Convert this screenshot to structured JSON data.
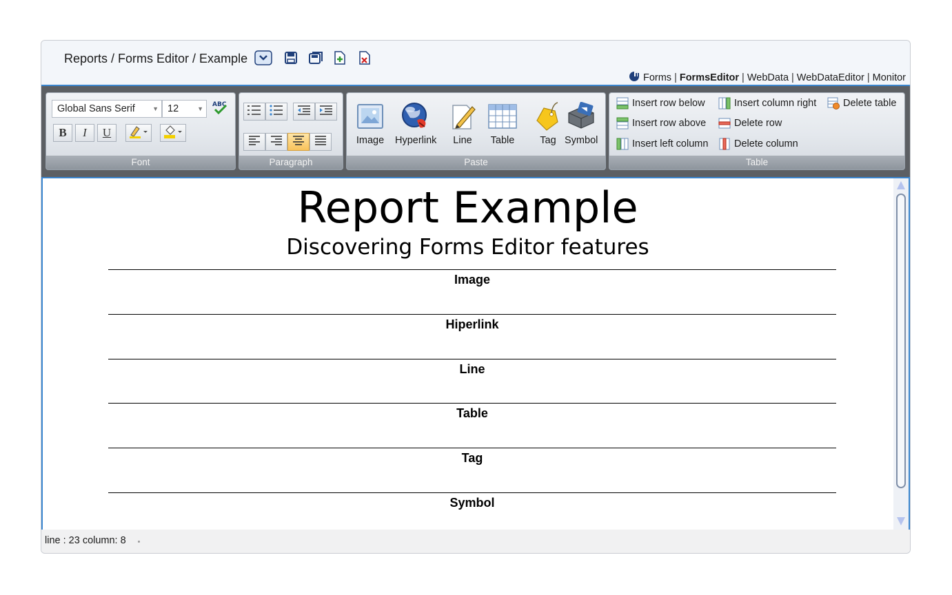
{
  "window": {
    "breadcrumb": "Reports / Forms Editor / Example",
    "toolbar_icons": [
      "chevron-down-icon",
      "save-icon",
      "save-as-icon",
      "new-document-icon",
      "close-document-icon"
    ]
  },
  "nav": {
    "links": [
      "Forms",
      "FormsEditor",
      "WebData",
      "WebDataEditor",
      "Monitor"
    ],
    "active": "FormsEditor",
    "separator": "|"
  },
  "ribbon": {
    "font": {
      "label": "Font",
      "family": "Global Sans Serif",
      "size": "12",
      "bold": "B",
      "italic": "I",
      "underline": "U"
    },
    "paragraph": {
      "label": "Paragraph",
      "selected_alignment": "center"
    },
    "paste": {
      "label": "Paste",
      "items": [
        "Image",
        "Hyperlink",
        "Line",
        "Table",
        "Tag",
        "Symbol"
      ]
    },
    "table": {
      "label": "Table",
      "commands": {
        "insert_row_below": "Insert row below",
        "insert_row_above": "Insert row above",
        "insert_left_column": "Insert left column",
        "insert_column_right": "Insert column right",
        "delete_row": "Delete row",
        "delete_column": "Delete column",
        "delete_table": "Delete table"
      }
    }
  },
  "document": {
    "title": "Report Example",
    "subtitle": "Discovering Forms Editor features",
    "rows": [
      "Image",
      "Hiperlink",
      "Line",
      "Table",
      "Tag",
      "Symbol"
    ]
  },
  "status": {
    "text": "line : 23 column: 8"
  },
  "colors": {
    "accent": "#3a86d0",
    "ribbon_background": "#5c5f63"
  }
}
